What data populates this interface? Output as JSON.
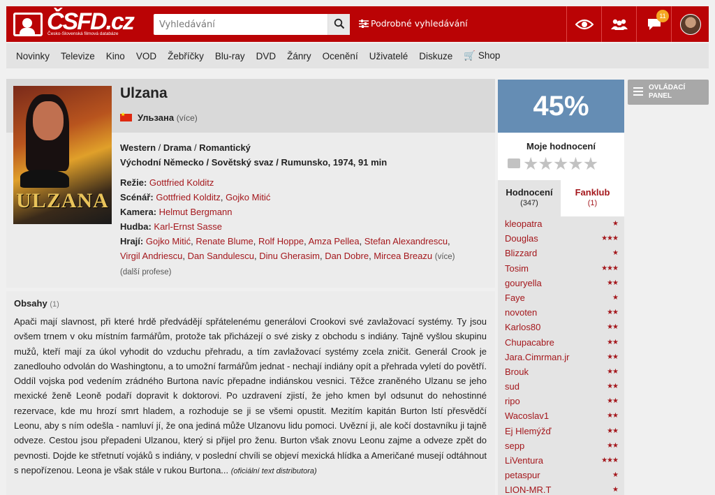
{
  "header": {
    "logo_text": "ČSFD.cz",
    "logo_subtitle": "Česko-Slovenská filmová databáze",
    "search_placeholder": "Vyhledávání",
    "advanced_search": "Podrobné vyhledávání",
    "notifications_count": "11"
  },
  "nav": [
    "Novinky",
    "Televize",
    "Kino",
    "VOD",
    "Žebříčky",
    "Blu-ray",
    "DVD",
    "Žánry",
    "Ocenění",
    "Uživatelé",
    "Diskuze",
    "Shop"
  ],
  "film": {
    "title": "Ulzana",
    "alt_title": "Ульзана",
    "alt_more": "(více)",
    "genres": [
      "Western",
      "Drama",
      "Romantický"
    ],
    "origin": "Východní Německo / Sovětský svaz / Rumunsko, 1974, 91 min",
    "poster_title": "ULZANA",
    "directing_label": "Režie:",
    "directing": "Gottfried Kolditz",
    "screenplay_label": "Scénář:",
    "screenplay": [
      "Gottfried Kolditz",
      "Gojko Mitić"
    ],
    "camera_label": "Kamera:",
    "camera": "Helmut Bergmann",
    "music_label": "Hudba:",
    "music": "Karl-Ernst Sasse",
    "cast_label": "Hrají:",
    "cast_line1": [
      "Gojko Mitić",
      "Renate Blume",
      "Rolf Hoppe",
      "Amza Pellea",
      "Stefan Alexandrescu"
    ],
    "cast_line2": [
      "Virgil Andriescu",
      "Dan Sandulescu",
      "Dinu Gherasim",
      "Dan Dobre",
      "Mircea Breazu"
    ],
    "cast_more": "(více)",
    "other_professions": "(další profese)"
  },
  "plot": {
    "title": "Obsahy",
    "count": "(1)",
    "text": "Apači mají slavnost, při které hrdě předvádějí spřátelenému generálovi Crookovi své zavlažovací systémy. Ty jsou ovšem trnem v oku místním farmářům, protože tak přicházejí o své zisky z obchodu s indiány. Tajně vyšlou skupinu mužů, kteří mají za úkol vyhodit do vzduchu přehradu, a tím zavlažovací systémy zcela zničit. Generál Crook je zanedlouho odvolán do Washingtonu, a to umožní farmářům jednat - nechají indiány opít a přehrada vyletí do povětří. Oddíl vojska pod vedením zrádného Burtona navíc přepadne indiánskou vesnici. Těžce zraněného Ulzanu se jeho mexické ženě Leoně podaří dopravit k doktorovi. Po uzdravení zjistí, že jeho kmen byl odsunut do nehostinné rezervace, kde mu hrozí smrt hladem, a rozhoduje se ji se všemi opustit. Mezitím kapitán Burton lstí přesvědčí Leonu, aby s ním odešla - namluví jí, že ona jediná může Ulzanovu lidu pomoci. Uvězní ji, ale kočí dostavníku ji tajně odveze. Cestou jsou přepadeni Ulzanou, který si přijel pro ženu. Burton však znovu Leonu zajme a odveze zpět do pevnosti. Dojde ke střetnutí vojáků s indiány, v poslední chvíli se objeví mexická hlídka a Američané musejí odtáhnout s nepořízenou. Leona je však stále v rukou Burtona...",
    "source": "(oficiální text distributora)"
  },
  "rating": {
    "percent": "45%",
    "my_rating_label": "Moje hodnocení",
    "tab_ratings": "Hodnocení",
    "tab_ratings_count": "(347)",
    "tab_fanclub": "Fanklub",
    "tab_fanclub_count": "(1)",
    "users": [
      {
        "name": "kleopatra",
        "stars": "★"
      },
      {
        "name": "Douglas",
        "stars": "★★★"
      },
      {
        "name": "Blizzard",
        "stars": "★"
      },
      {
        "name": "Tosim",
        "stars": "★★★"
      },
      {
        "name": "gouryella",
        "stars": "★★"
      },
      {
        "name": "Faye",
        "stars": "★"
      },
      {
        "name": "novoten",
        "stars": "★★"
      },
      {
        "name": "Karlos80",
        "stars": "★★"
      },
      {
        "name": "Chupacabre",
        "stars": "★★"
      },
      {
        "name": "Jara.Cimrman.jr",
        "stars": "★★"
      },
      {
        "name": "Brouk",
        "stars": "★★"
      },
      {
        "name": "sud",
        "stars": "★★"
      },
      {
        "name": "ripo",
        "stars": "★★"
      },
      {
        "name": "Wacoslav1",
        "stars": "★★"
      },
      {
        "name": "Ej Hlemýžď",
        "stars": "★★"
      },
      {
        "name": "sepp",
        "stars": "★★"
      },
      {
        "name": "LiVentura",
        "stars": "★★★"
      },
      {
        "name": "petaspur",
        "stars": "★"
      },
      {
        "name": "LION-MR.T",
        "stars": "★"
      }
    ]
  },
  "control_panel": "OVLÁDACÍ PANEL",
  "colors": {
    "brand_red": "#ba0305",
    "rating_blue": "#658db4",
    "link_red": "#a4171c"
  }
}
